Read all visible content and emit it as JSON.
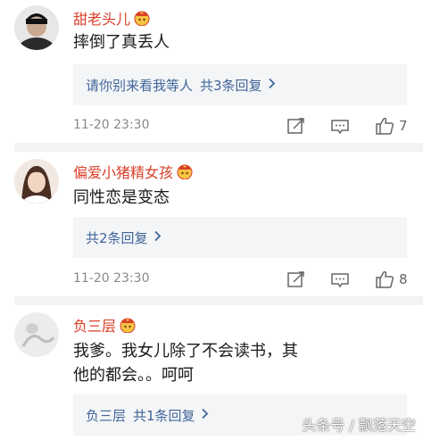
{
  "comments": [
    {
      "username": "甜老头儿",
      "text": "摔倒了真丢人",
      "reply_prefix": "请你别来看我等人",
      "reply_count": "共3条回复",
      "time": "11-20 23:30",
      "likes": "7"
    },
    {
      "username": "偏爱小猪精女孩",
      "text": "同性恋是变态",
      "reply_prefix": "",
      "reply_count": "共2条回复",
      "time": "11-20 23:30",
      "likes": "8"
    },
    {
      "username": "负三层",
      "text": "我爹。我女儿除了不会读书，其他的都会。。呵呵",
      "reply_prefix": "负三层",
      "reply_count": "共1条回复",
      "time": "",
      "likes": ""
    }
  ],
  "watermark": "头条号 / 飘落天空",
  "icons": {
    "badge": "crown-badge-icon",
    "reply_arrow": "chevron-right-icon",
    "share": "share-edit-icon",
    "comment": "comment-bubble-icon",
    "like": "thumbs-up-icon"
  },
  "colors": {
    "username": "#d9402a",
    "reply_link": "#406599",
    "reply_bg": "#f4f5f7",
    "meta": "#888888"
  }
}
